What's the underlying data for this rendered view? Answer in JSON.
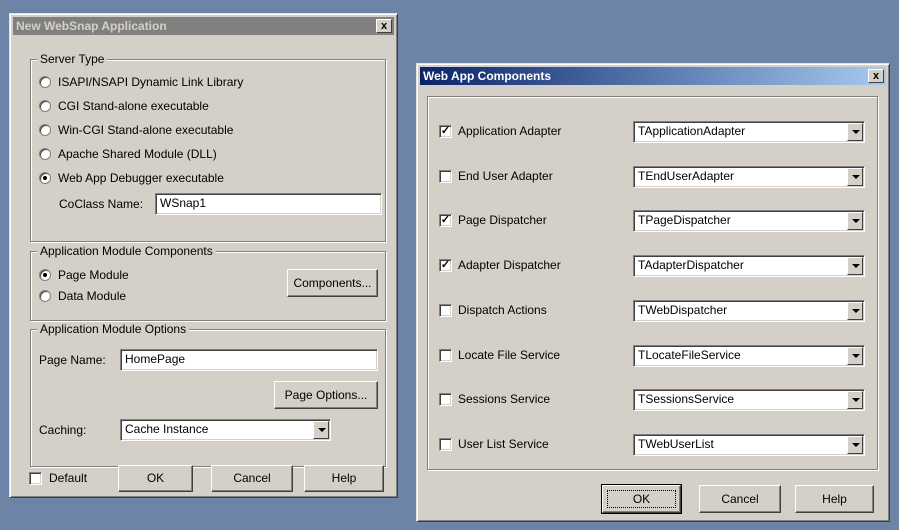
{
  "left_dialog": {
    "title": "New WebSnap Application",
    "close": "x",
    "server_type": {
      "legend": "Server Type",
      "options": [
        {
          "label": "ISAPI/NSAPI Dynamic Link Library",
          "selected": false
        },
        {
          "label": "CGI Stand-alone executable",
          "selected": false
        },
        {
          "label": "Win-CGI Stand-alone executable",
          "selected": false
        },
        {
          "label": "Apache Shared Module (DLL)",
          "selected": false
        },
        {
          "label": "Web App Debugger executable",
          "selected": true
        }
      ],
      "coclass_label": "CoClass Name:",
      "coclass_value": "WSnap1"
    },
    "module_components": {
      "legend": "Application Module Components",
      "options": [
        {
          "label": "Page Module",
          "selected": true
        },
        {
          "label": "Data Module",
          "selected": false
        }
      ],
      "components_button": "Components..."
    },
    "module_options": {
      "legend": "Application Module Options",
      "page_name_label": "Page Name:",
      "page_name_value": "HomePage",
      "page_options_button": "Page Options...",
      "caching_label": "Caching:",
      "caching_value": "Cache Instance"
    },
    "footer": {
      "default_label": "Default",
      "default_checked": false,
      "ok": "OK",
      "cancel": "Cancel",
      "help": "Help"
    }
  },
  "right_dialog": {
    "title": "Web App Components",
    "close": "x",
    "components": [
      {
        "label": "Application Adapter",
        "checked": true,
        "class": "TApplicationAdapter"
      },
      {
        "label": "End User Adapter",
        "checked": false,
        "class": "TEndUserAdapter"
      },
      {
        "label": "Page Dispatcher",
        "checked": true,
        "class": "TPageDispatcher"
      },
      {
        "label": "Adapter Dispatcher",
        "checked": true,
        "class": "TAdapterDispatcher"
      },
      {
        "label": "Dispatch Actions",
        "checked": false,
        "class": "TWebDispatcher"
      },
      {
        "label": "Locate File Service",
        "checked": false,
        "class": "TLocateFileService"
      },
      {
        "label": "Sessions Service",
        "checked": false,
        "class": "TSessionsService"
      },
      {
        "label": "User List Service",
        "checked": false,
        "class": "TWebUserList"
      }
    ],
    "footer": {
      "ok": "OK",
      "cancel": "Cancel",
      "help": "Help"
    }
  },
  "colors": {
    "desktop": "#6e84a6",
    "face": "#d4d0c8",
    "active_title": "#0a246a",
    "inactive_title": "#808080"
  }
}
